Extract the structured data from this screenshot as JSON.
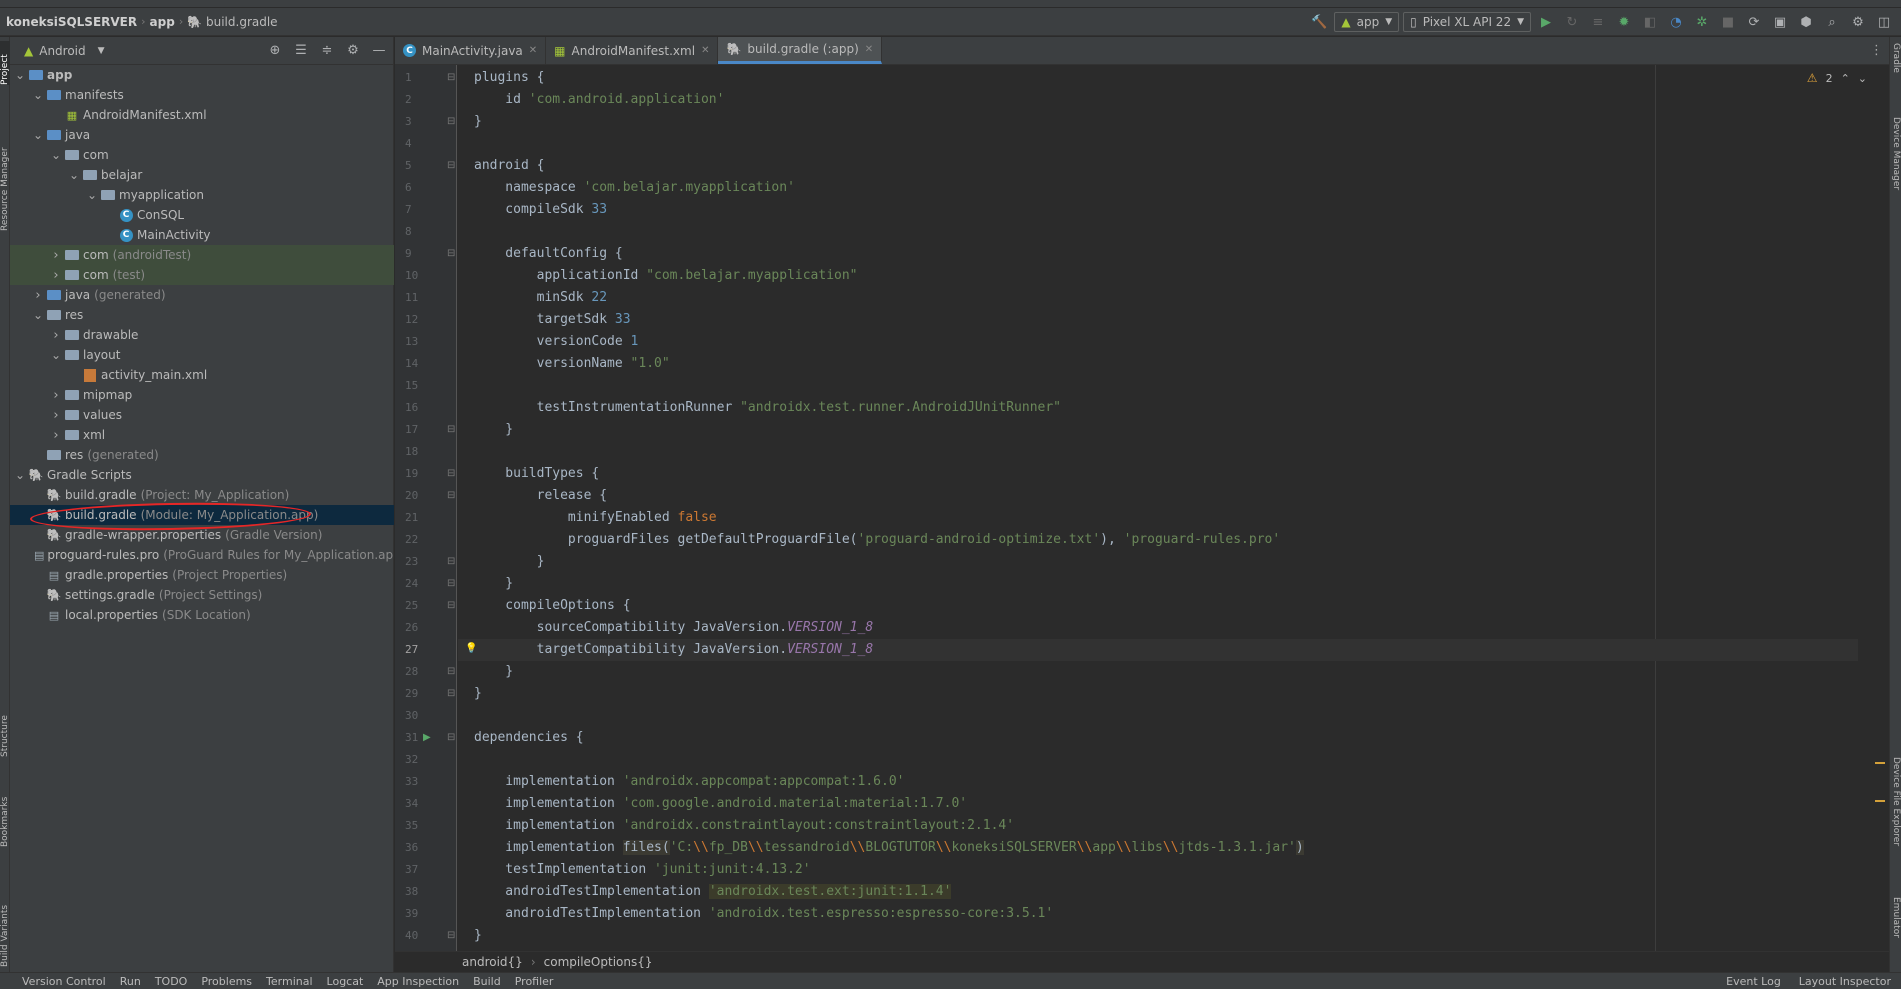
{
  "breadcrumb": [
    "koneksiSQLSERVER",
    "app",
    "build.gradle"
  ],
  "toolbar": {
    "run_config": "app",
    "device": "Pixel XL API 22"
  },
  "left_strip_tabs": [
    "Project",
    "Resource Manager",
    "Structure",
    "Bookmarks",
    "Build Variants"
  ],
  "right_strip_tabs": [
    "Gradle",
    "Device Manager",
    "Device File Explorer",
    "Emulator"
  ],
  "project_panel": {
    "view": "Android",
    "tree": [
      {
        "label": "app",
        "extra": "",
        "depth": 0,
        "arrow": "down",
        "icon": "folder-blue"
      },
      {
        "label": "manifests",
        "extra": "",
        "depth": 1,
        "arrow": "down",
        "icon": "folder-blue"
      },
      {
        "label": "AndroidManifest.xml",
        "extra": "",
        "depth": 2,
        "arrow": "",
        "icon": "manifest"
      },
      {
        "label": "java",
        "extra": "",
        "depth": 1,
        "arrow": "down",
        "icon": "folder-blue"
      },
      {
        "label": "com",
        "extra": "",
        "depth": 2,
        "arrow": "down",
        "icon": "folder"
      },
      {
        "label": "belajar",
        "extra": "",
        "depth": 3,
        "arrow": "down",
        "icon": "folder"
      },
      {
        "label": "myapplication",
        "extra": "",
        "depth": 4,
        "arrow": "down",
        "icon": "folder"
      },
      {
        "label": "ConSQL",
        "extra": "",
        "depth": 5,
        "arrow": "",
        "icon": "class"
      },
      {
        "label": "MainActivity",
        "extra": "",
        "depth": 5,
        "arrow": "",
        "icon": "class"
      },
      {
        "label": "com",
        "extra": "(androidTest)",
        "depth": 2,
        "arrow": "right",
        "icon": "folder",
        "state": "hl"
      },
      {
        "label": "com",
        "extra": "(test)",
        "depth": 2,
        "arrow": "right",
        "icon": "folder",
        "state": "hl"
      },
      {
        "label": "java",
        "extra": "(generated)",
        "depth": 1,
        "arrow": "right",
        "icon": "folder-blue"
      },
      {
        "label": "res",
        "extra": "",
        "depth": 1,
        "arrow": "down",
        "icon": "folder"
      },
      {
        "label": "drawable",
        "extra": "",
        "depth": 2,
        "arrow": "right",
        "icon": "folder"
      },
      {
        "label": "layout",
        "extra": "",
        "depth": 2,
        "arrow": "down",
        "icon": "folder"
      },
      {
        "label": "activity_main.xml",
        "extra": "",
        "depth": 3,
        "arrow": "",
        "icon": "xml"
      },
      {
        "label": "mipmap",
        "extra": "",
        "depth": 2,
        "arrow": "right",
        "icon": "folder"
      },
      {
        "label": "values",
        "extra": "",
        "depth": 2,
        "arrow": "right",
        "icon": "folder"
      },
      {
        "label": "xml",
        "extra": "",
        "depth": 2,
        "arrow": "right",
        "icon": "folder"
      },
      {
        "label": "res",
        "extra": "(generated)",
        "depth": 1,
        "arrow": "",
        "icon": "folder"
      },
      {
        "label": "Gradle Scripts",
        "extra": "",
        "depth": 0,
        "arrow": "down",
        "icon": "gradle"
      },
      {
        "label": "build.gradle",
        "extra": "(Project: My_Application)",
        "depth": 1,
        "arrow": "",
        "icon": "gradle"
      },
      {
        "label": "build.gradle",
        "extra": "(Module: My_Application.app)",
        "depth": 1,
        "arrow": "",
        "icon": "gradle",
        "state": "sel"
      },
      {
        "label": "gradle-wrapper.properties",
        "extra": "(Gradle Version)",
        "depth": 1,
        "arrow": "",
        "icon": "gradle"
      },
      {
        "label": "proguard-rules.pro",
        "extra": "(ProGuard Rules for My_Application.app)",
        "depth": 1,
        "arrow": "",
        "icon": "file"
      },
      {
        "label": "gradle.properties",
        "extra": "(Project Properties)",
        "depth": 1,
        "arrow": "",
        "icon": "file"
      },
      {
        "label": "settings.gradle",
        "extra": "(Project Settings)",
        "depth": 1,
        "arrow": "",
        "icon": "gradle"
      },
      {
        "label": "local.properties",
        "extra": "(SDK Location)",
        "depth": 1,
        "arrow": "",
        "icon": "file"
      }
    ]
  },
  "editor_tabs": [
    {
      "label": "MainActivity.java",
      "icon": "class",
      "active": false
    },
    {
      "label": "AndroidManifest.xml",
      "icon": "manifest",
      "active": false
    },
    {
      "label": "build.gradle (:app)",
      "icon": "gradle",
      "active": true
    }
  ],
  "editor": {
    "warning_count": "2",
    "current_line": 27,
    "lines": [
      [
        [
          "plain",
          "plugins {"
        ]
      ],
      [
        [
          "plain",
          "    id "
        ],
        [
          "str",
          "'com.android.application'"
        ]
      ],
      [
        [
          "plain",
          "}"
        ]
      ],
      [],
      [
        [
          "plain",
          "android {"
        ]
      ],
      [
        [
          "plain",
          "    namespace "
        ],
        [
          "str",
          "'com.belajar.myapplication'"
        ]
      ],
      [
        [
          "plain",
          "    compileSdk "
        ],
        [
          "num",
          "33"
        ]
      ],
      [],
      [
        [
          "plain",
          "    defaultConfig {"
        ]
      ],
      [
        [
          "plain",
          "        applicationId "
        ],
        [
          "str",
          "\"com.belajar.myapplication\""
        ]
      ],
      [
        [
          "plain",
          "        minSdk "
        ],
        [
          "num",
          "22"
        ]
      ],
      [
        [
          "plain",
          "        targetSdk "
        ],
        [
          "num",
          "33"
        ]
      ],
      [
        [
          "plain",
          "        versionCode "
        ],
        [
          "num",
          "1"
        ]
      ],
      [
        [
          "plain",
          "        versionName "
        ],
        [
          "str",
          "\"1.0\""
        ]
      ],
      [],
      [
        [
          "plain",
          "        testInstrumentationRunner "
        ],
        [
          "str",
          "\"androidx.test.runner.AndroidJUnitRunner\""
        ]
      ],
      [
        [
          "plain",
          "    }"
        ]
      ],
      [],
      [
        [
          "plain",
          "    buildTypes {"
        ]
      ],
      [
        [
          "plain",
          "        release {"
        ]
      ],
      [
        [
          "plain",
          "            minifyEnabled "
        ],
        [
          "kw",
          "false"
        ]
      ],
      [
        [
          "plain",
          "            proguardFiles getDefaultProguardFile("
        ],
        [
          "str",
          "'proguard-android-optimize.txt'"
        ],
        [
          "plain",
          "), "
        ],
        [
          "str",
          "'proguard-rules.pro'"
        ]
      ],
      [
        [
          "plain",
          "        }"
        ]
      ],
      [
        [
          "plain",
          "    }"
        ]
      ],
      [
        [
          "plain",
          "    compileOptions {"
        ]
      ],
      [
        [
          "plain",
          "        sourceCompatibility JavaVersion."
        ],
        [
          "const",
          "VERSION_1_8"
        ]
      ],
      [
        [
          "plain",
          "        targetCompatibility JavaVersion."
        ],
        [
          "const",
          "VERSION_1_8"
        ]
      ],
      [
        [
          "plain",
          "    }"
        ]
      ],
      [
        [
          "plain",
          "}"
        ]
      ],
      [],
      [
        [
          "plain",
          "dependencies {"
        ]
      ],
      [],
      [
        [
          "plain",
          "    implementation "
        ],
        [
          "str",
          "'androidx.appcompat:appcompat:1.6.0'"
        ]
      ],
      [
        [
          "plain",
          "    implementation "
        ],
        [
          "str",
          "'com.google.android.material:material:1.7.0'"
        ]
      ],
      [
        [
          "plain",
          "    implementation "
        ],
        [
          "str",
          "'androidx.constraintlayout:constraintlayout:2.1.4'"
        ]
      ],
      [
        [
          "plain",
          "    implementation "
        ],
        [
          "filehl",
          "files("
        ],
        [
          "str",
          "'C:"
        ],
        [
          "escp",
          "\\\\"
        ],
        [
          "str",
          "fp_DB"
        ],
        [
          "escp",
          "\\\\"
        ],
        [
          "str",
          "tessandroid"
        ],
        [
          "escp",
          "\\\\"
        ],
        [
          "str",
          "BLOGTUTOR"
        ],
        [
          "escp",
          "\\\\"
        ],
        [
          "str",
          "koneksiSQLSERVER"
        ],
        [
          "escp",
          "\\\\"
        ],
        [
          "str",
          "app"
        ],
        [
          "escp",
          "\\\\"
        ],
        [
          "str",
          "libs"
        ],
        [
          "escp",
          "\\\\"
        ],
        [
          "str",
          "jtds-1.3.1.jar'"
        ],
        [
          "filehl",
          ")"
        ]
      ],
      [
        [
          "plain",
          "    testImplementation "
        ],
        [
          "str",
          "'junit:junit:4.13.2'"
        ]
      ],
      [
        [
          "plain",
          "    androidTestImplementation "
        ],
        [
          "strhl",
          "'androidx.test.ext:junit:1.1.4'"
        ]
      ],
      [
        [
          "plain",
          "    androidTestImplementation "
        ],
        [
          "str",
          "'androidx.test.espresso:espresso-core:3.5.1'"
        ]
      ],
      [
        [
          "plain",
          "}"
        ]
      ]
    ]
  },
  "editor_crumbs": [
    "android{}",
    "compileOptions{}"
  ],
  "bottom_bar": {
    "left": [
      "Version Control",
      "Run",
      "TODO",
      "Problems",
      "Terminal",
      "Logcat",
      "App Inspection",
      "Build",
      "Profiler"
    ],
    "right": [
      "Event Log",
      "Layout Inspector"
    ]
  },
  "colors": {
    "accent": "#4a88c7",
    "annotation_circle": "#e52727",
    "selected_row": "#0d293e",
    "highlight_row": "#3f4d3c"
  }
}
